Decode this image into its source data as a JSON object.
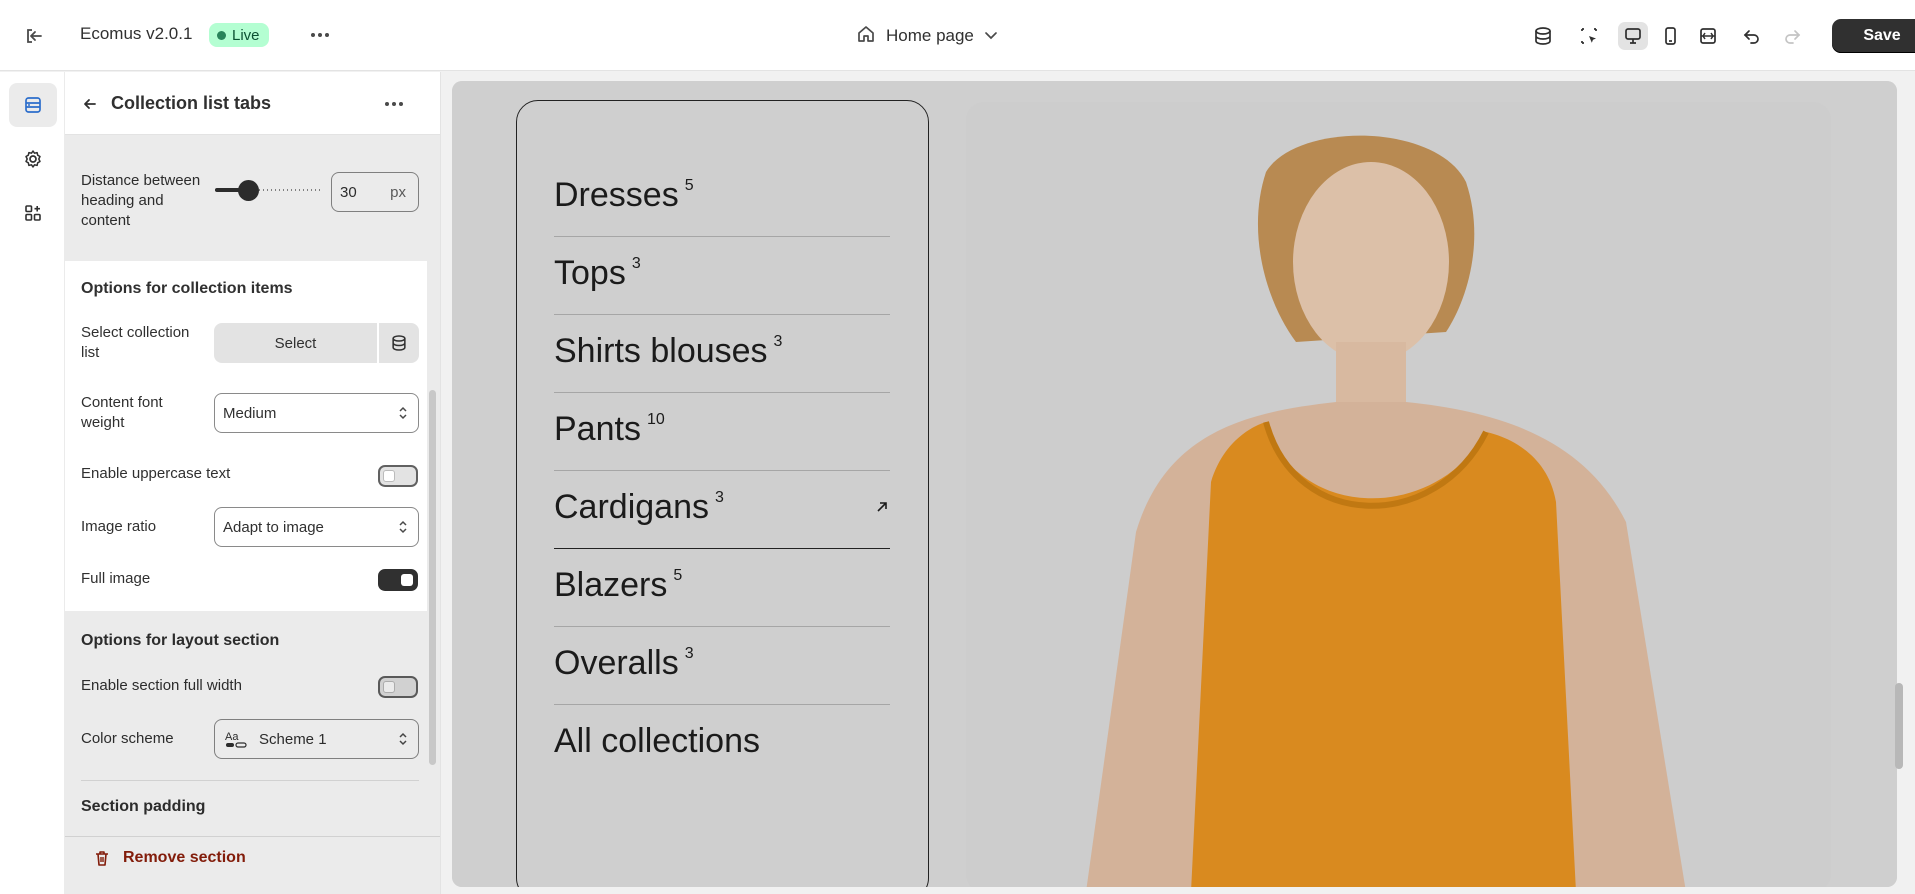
{
  "topbar": {
    "app_name": "Ecomus v2.0.1",
    "live_label": "Live",
    "page_label": "Home page",
    "save_label": "Save"
  },
  "panel": {
    "title": "Collection list tabs",
    "distance_label": "Distance between heading and content",
    "distance_value": "30",
    "distance_unit": "px",
    "distance_slider_fraction": 0.3,
    "options_items_title": "Options for collection items",
    "select_collection_label": "Select collection list",
    "select_button_label": "Select",
    "content_font_weight_label": "Content font weight",
    "content_font_weight_value": "Medium",
    "uppercase_label": "Enable uppercase text",
    "uppercase_on": false,
    "image_ratio_label": "Image ratio",
    "image_ratio_value": "Adapt to image",
    "full_image_label": "Full image",
    "full_image_on": true,
    "layout_title": "Options for layout section",
    "full_width_label": "Enable section full width",
    "full_width_on": false,
    "color_scheme_label": "Color scheme",
    "color_scheme_value": "Scheme 1",
    "section_padding_title": "Section padding",
    "remove_label": "Remove section"
  },
  "preview": {
    "collections": [
      {
        "name": "Dresses",
        "count": "5"
      },
      {
        "name": "Tops",
        "count": "3"
      },
      {
        "name": "Shirts blouses",
        "count": "3"
      },
      {
        "name": "Pants",
        "count": "10"
      },
      {
        "name": "Cardigans",
        "count": "3"
      },
      {
        "name": "Blazers",
        "count": "5"
      },
      {
        "name": "Overalls",
        "count": "3"
      },
      {
        "name": "All collections",
        "count": ""
      }
    ]
  },
  "colors": {
    "accent_dark": "#303030",
    "live_badge_bg": "#b4fed2",
    "remove_red": "#8e1f0b",
    "tank_top_orange": "#e8901a"
  },
  "icons": [
    "exit-icon",
    "more-horizontal-icon",
    "home-icon",
    "chevron-down-icon",
    "database-icon",
    "select-element-icon",
    "desktop-icon",
    "mobile-icon",
    "fullwidth-icon",
    "undo-icon",
    "redo-icon",
    "sections-icon",
    "gear-icon",
    "apps-icon",
    "back-arrow-icon",
    "trash-icon",
    "arrow-up-right-icon",
    "color-scheme-icon"
  ]
}
